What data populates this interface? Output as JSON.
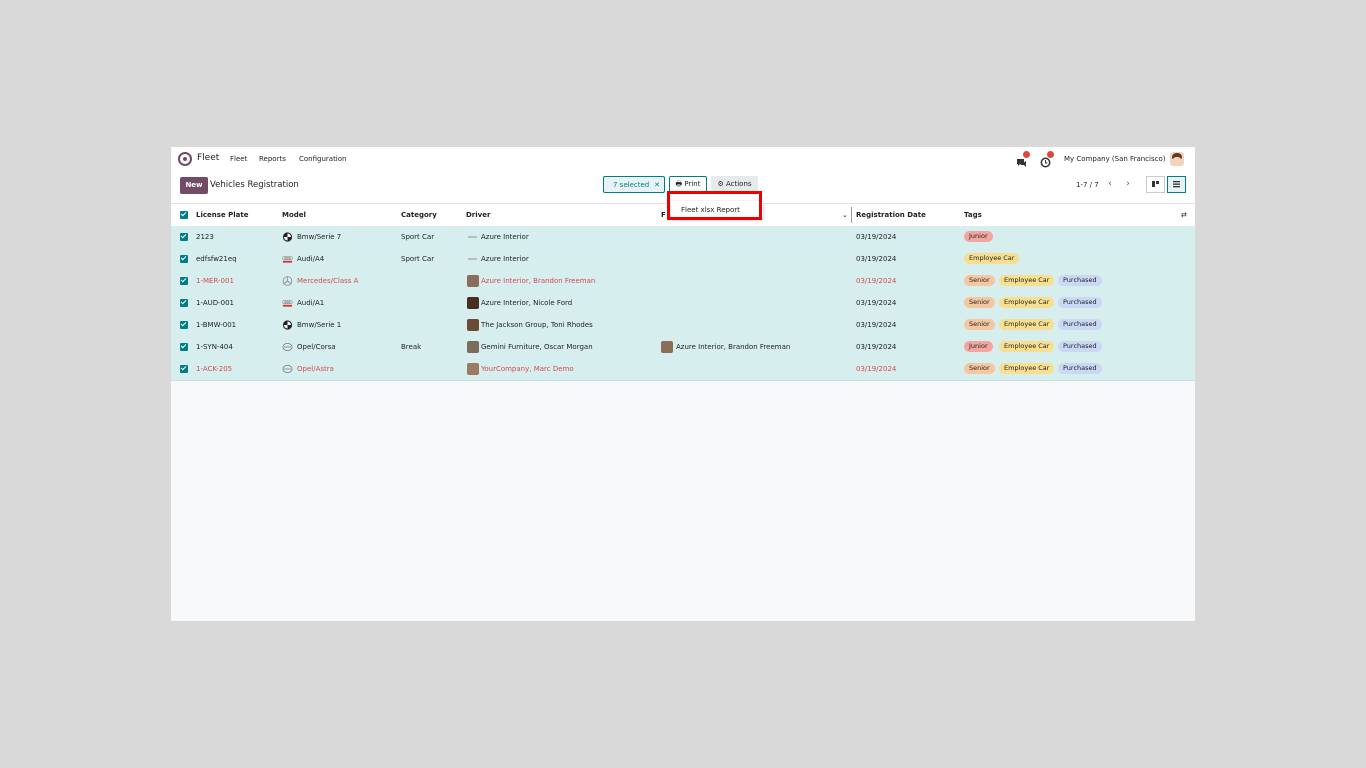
{
  "nav": {
    "app_name": "Fleet",
    "menu": [
      "Fleet",
      "Reports",
      "Configuration"
    ],
    "company": "My Company (San Francisco)",
    "messages_badge": "4",
    "activities_badge": "2"
  },
  "control": {
    "new_label": "New",
    "title": "Vehicles Registration",
    "selected_label": "7 selected",
    "print_label": "Print",
    "actions_label": "Actions",
    "pager": "1-7 / 7"
  },
  "print_menu": {
    "items": [
      "Fleet xlsx Report"
    ]
  },
  "table": {
    "columns": {
      "license_plate": "License Plate",
      "model": "Model",
      "category": "Category",
      "driver": "Driver",
      "future_driver": "F",
      "registration_date": "Registration Date",
      "tags": "Tags"
    },
    "rows": [
      {
        "plate": "2123",
        "model": "Bmw/Serie 7",
        "category": "Sport Car",
        "driver": "Azure Interior",
        "future_driver": "",
        "date": "03/19/2024",
        "tags": [
          "Junior"
        ]
      },
      {
        "plate": "edfsfw21eq",
        "model": "Audi/A4",
        "category": "Sport Car",
        "driver": "Azure Interior",
        "future_driver": "",
        "date": "03/19/2024",
        "tags": [
          "Employee Car"
        ]
      },
      {
        "plate": "1-MER-001",
        "model": "Mercedes/Class A",
        "category": "",
        "driver": "Azure Interior, Brandon Freeman",
        "future_driver": "",
        "date": "03/19/2024",
        "tags": [
          "Senior",
          "Employee Car",
          "Purchased"
        ]
      },
      {
        "plate": "1-AUD-001",
        "model": "Audi/A1",
        "category": "",
        "driver": "Azure Interior, Nicole Ford",
        "future_driver": "",
        "date": "03/19/2024",
        "tags": [
          "Senior",
          "Employee Car",
          "Purchased"
        ]
      },
      {
        "plate": "1-BMW-001",
        "model": "Bmw/Serie 1",
        "category": "",
        "driver": "The Jackson Group, Toni Rhodes",
        "future_driver": "",
        "date": "03/19/2024",
        "tags": [
          "Senior",
          "Employee Car",
          "Purchased"
        ]
      },
      {
        "plate": "1-SYN-404",
        "model": "Opel/Corsa",
        "category": "Break",
        "driver": "Gemini Furniture, Oscar Morgan",
        "future_driver": "Azure Interior, Brandon Freeman",
        "date": "03/19/2024",
        "tags": [
          "Junior",
          "Employee Car",
          "Purchased"
        ]
      },
      {
        "plate": "1-ACK-205",
        "model": "Opel/Astra",
        "category": "",
        "driver": "YourCompany, Marc Demo",
        "future_driver": "",
        "date": "03/19/2024",
        "tags": [
          "Senior",
          "Employee Car",
          "Purchased"
        ]
      }
    ]
  },
  "colors": {
    "brand": "#714b67",
    "accent": "#017e84",
    "row_selected": "#d7eeef",
    "overdue_text": "#d44c4c",
    "highlight_box": "#ee0000"
  }
}
